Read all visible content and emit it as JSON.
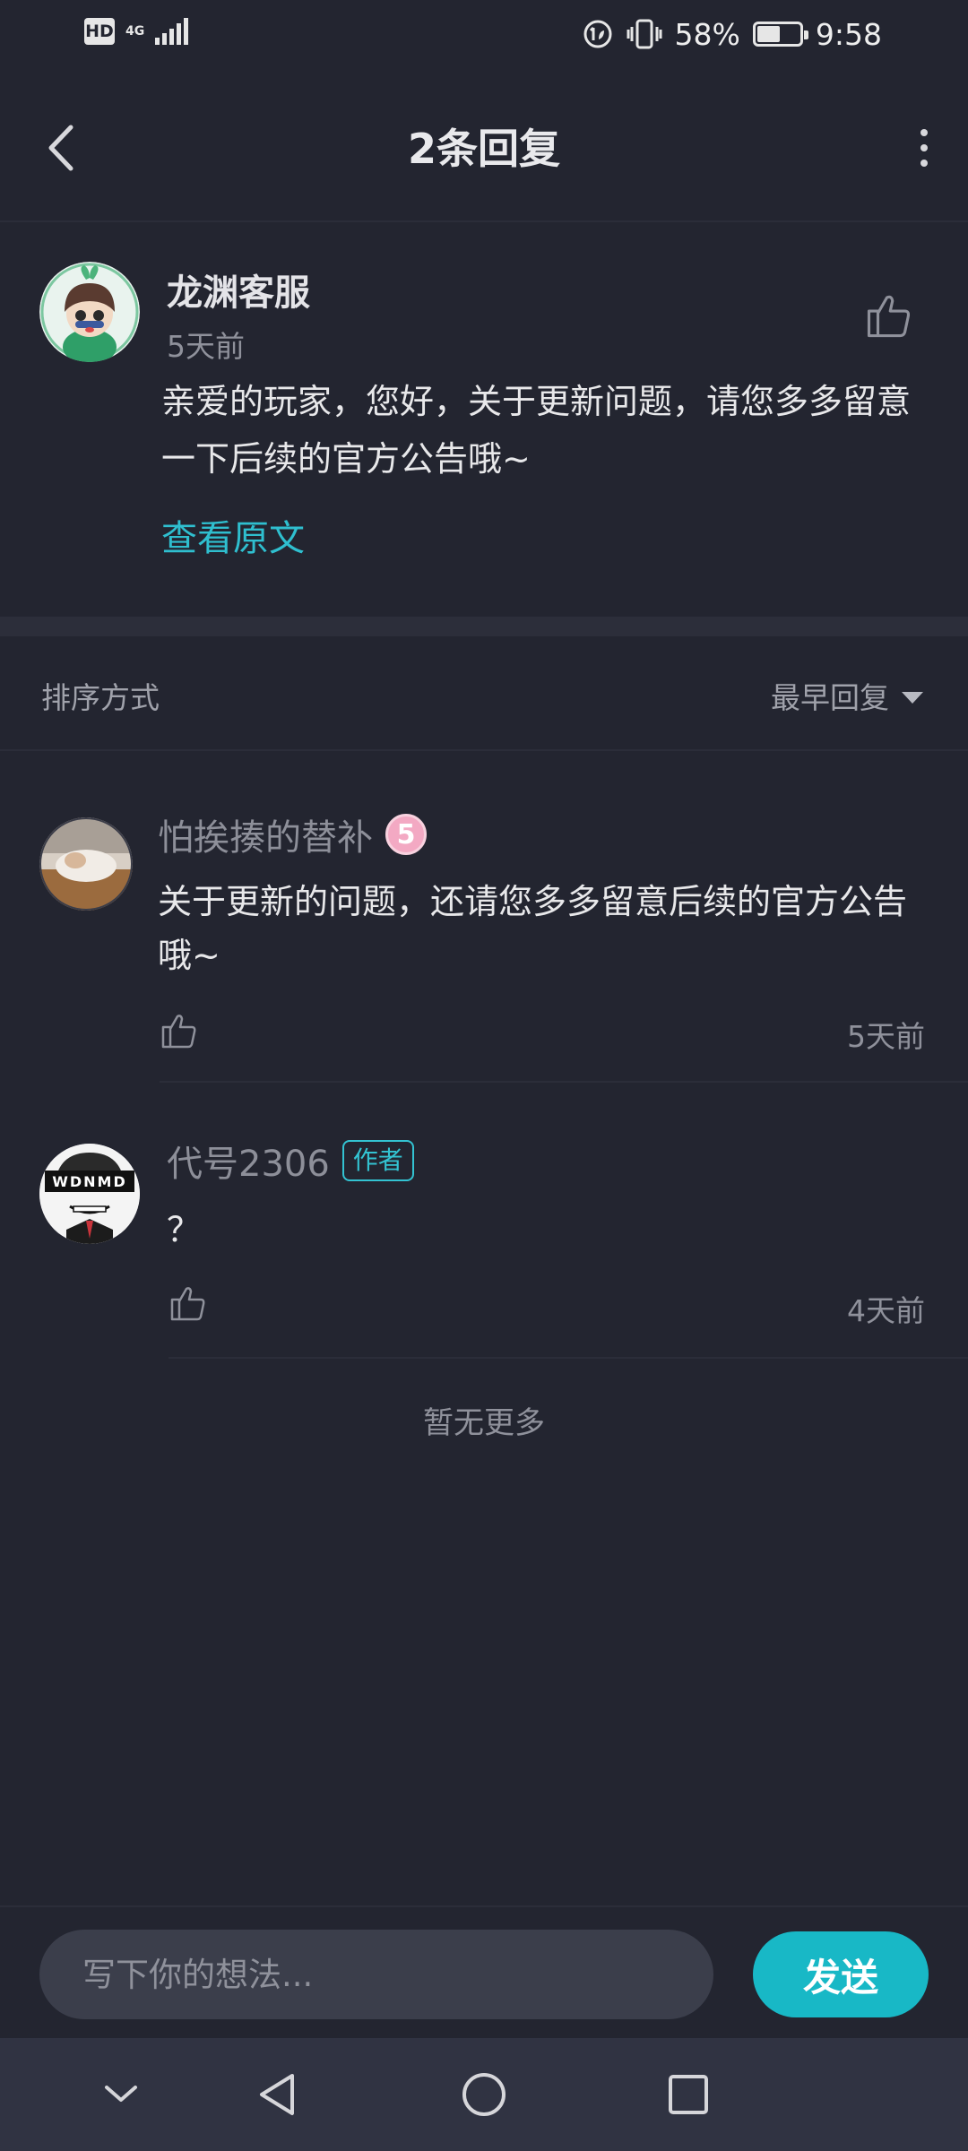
{
  "status_bar": {
    "hd": "HD",
    "network": "4G",
    "battery_percent": "58%",
    "battery_level": 0.58,
    "time": "9:58"
  },
  "header": {
    "title": "2条回复"
  },
  "main_comment": {
    "author": "龙渊客服",
    "time": "5天前",
    "body": "亲爱的玩家，您好，关于更新问题，请您多多留意一下后续的官方公告哦~",
    "view_original": "查看原文"
  },
  "sort": {
    "label": "排序方式",
    "selected": "最早回复"
  },
  "replies": [
    {
      "author": "怕挨揍的替补",
      "level": "5",
      "body": "关于更新的问题，还请您多多留意后续的官方公告哦~",
      "time": "5天前"
    },
    {
      "author": "代号2306",
      "tag": "作者",
      "avatar_text": "WDNMD",
      "body": "？",
      "time": "4天前"
    }
  ],
  "footer_note": "暂无更多",
  "composer": {
    "placeholder": "写下你的想法...",
    "send_label": "发送"
  },
  "colors": {
    "background": "#232530",
    "accent": "#18b8c6",
    "link": "#2fbfcf"
  }
}
